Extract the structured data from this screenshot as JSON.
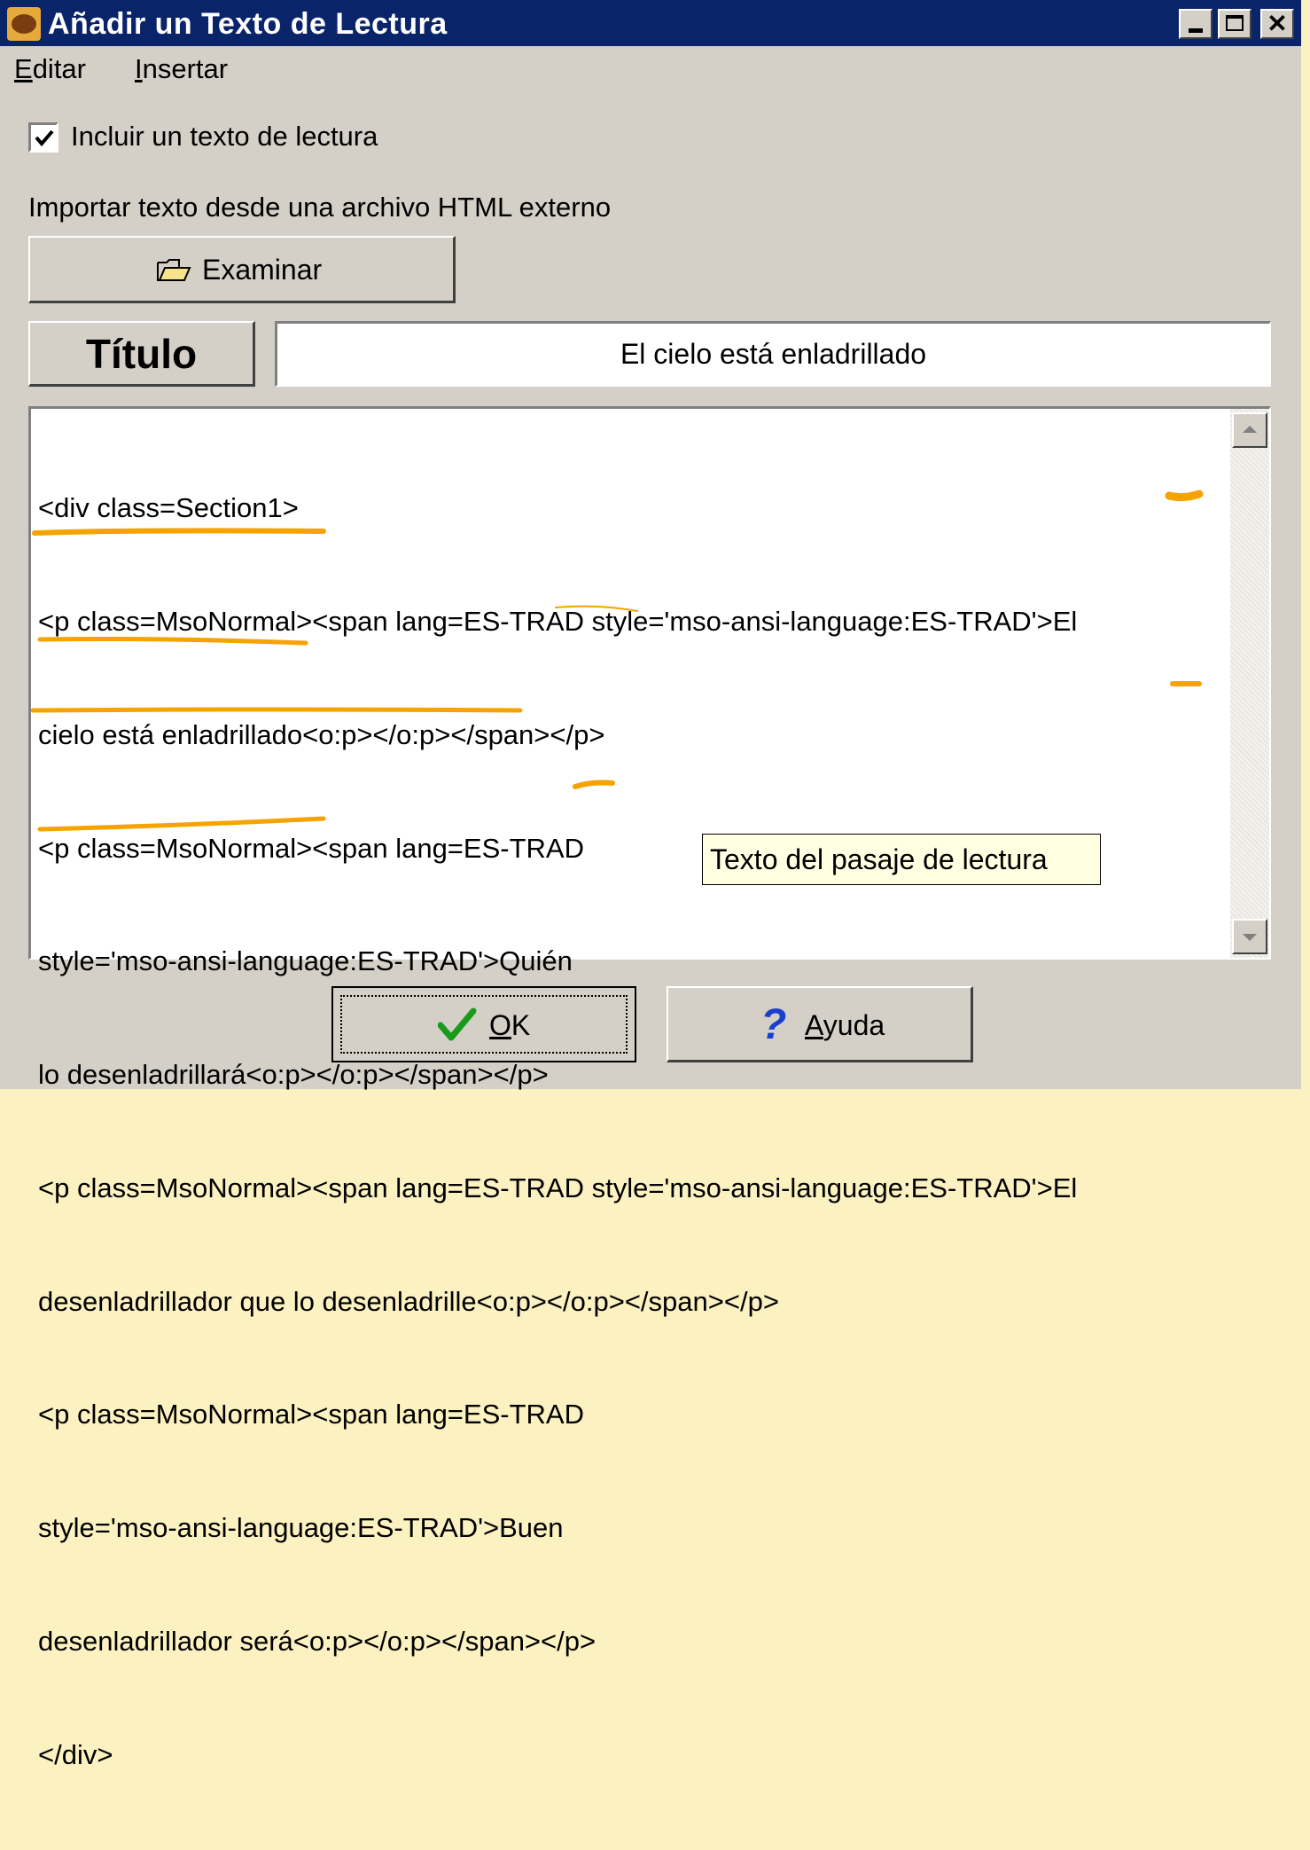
{
  "window": {
    "title": "Añadir un Texto de Lectura",
    "buttons": {
      "minimize": "_",
      "maximize": "□",
      "close": "✕"
    }
  },
  "menu": {
    "edit": {
      "accel": "E",
      "rest": "ditar"
    },
    "insert": {
      "accel": "I",
      "rest": "nsertar"
    }
  },
  "include_checkbox": {
    "checked": true,
    "label": "Incluir un texto de lectura"
  },
  "import_label": "Importar texto desde una archivo HTML externo",
  "browse_button": {
    "label": "Examinar",
    "icon": "folder-open-icon"
  },
  "title_field": {
    "label": "Título",
    "value": "El cielo está enladrillado"
  },
  "reading_text": {
    "lines": [
      "<div class=Section1>",
      "<p class=MsoNormal><span lang=ES-TRAD style='mso-ansi-language:ES-TRAD'>El",
      "cielo está enladrillado<o:p></o:p></span></p>",
      "<p class=MsoNormal><span lang=ES-TRAD",
      "style='mso-ansi-language:ES-TRAD'>Quién",
      "lo desenladrillará<o:p></o:p></span></p>",
      "<p class=MsoNormal><span lang=ES-TRAD style='mso-ansi-language:ES-TRAD'>El",
      "desenladrillador que lo desenladrille<o:p></o:p></span></p>",
      "<p class=MsoNormal><span lang=ES-TRAD",
      "style='mso-ansi-language:ES-TRAD'>Buen",
      "desenladrillador será<o:p></o:p></span></p>",
      "</div>"
    ]
  },
  "tooltip": "Texto del pasaje de lectura",
  "ok_button": {
    "accel": "O",
    "rest": "K",
    "icon": "checkmark-icon"
  },
  "help_button": {
    "accel": "A",
    "rest": "yuda",
    "icon": "question-icon"
  },
  "colors": {
    "titlebar": "#0a246a",
    "dialog_bg": "#d4d0c8",
    "annotation": "#f5a300",
    "tooltip_bg": "#ffffe1",
    "ok_check": "#1a9a1a",
    "help_question": "#1a3fd0"
  }
}
